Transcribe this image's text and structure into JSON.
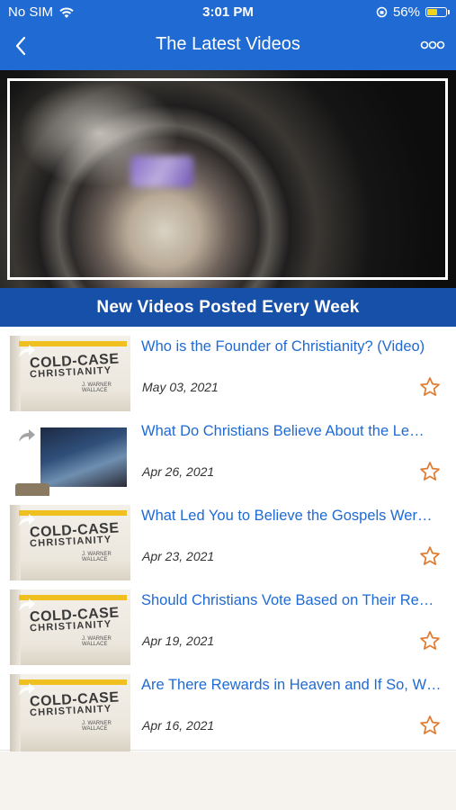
{
  "status_bar": {
    "carrier": "No SIM",
    "time": "3:01 PM",
    "battery_percent": "56%",
    "battery_level": 0.56
  },
  "nav": {
    "title": "The Latest Videos",
    "back_icon": "chevron-left-icon",
    "more_icon": "more-horizontal-icon"
  },
  "banner": {
    "text": "New Videos Posted Every Week"
  },
  "book_cover": {
    "line1": "COLD-CASE",
    "line2": "CHRISTIANITY",
    "author": "J. WARNER WALLACE"
  },
  "videos": [
    {
      "title": "Who is the Founder of Christianity? (Video)",
      "date": "May 03, 2021"
    },
    {
      "title": "What Do Christians Believe About the Le…",
      "date": "Apr 26, 2021"
    },
    {
      "title": "What Led You to Believe the Gospels Wer…",
      "date": "Apr 23, 2021"
    },
    {
      "title": "Should Christians Vote Based on Their Re…",
      "date": "Apr 19, 2021"
    },
    {
      "title": "Are There Rewards in Heaven and If So, W…",
      "date": "Apr 16, 2021"
    }
  ],
  "colors": {
    "accent": "#1f6ad3",
    "banner": "#1650a8",
    "star": "#e07a2e"
  }
}
